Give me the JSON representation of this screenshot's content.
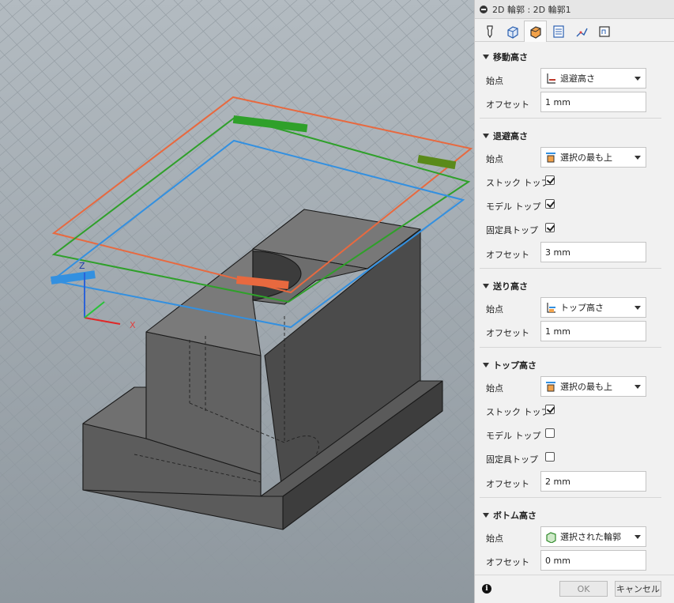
{
  "panel": {
    "title": "2D 輪郭 : 2D 輪郭1",
    "tabs": [
      {
        "icon": "tool-icon"
      },
      {
        "icon": "geometry-icon"
      },
      {
        "icon": "heights-icon"
      },
      {
        "icon": "passes-icon"
      },
      {
        "icon": "linking-icon"
      },
      {
        "icon": "shape-icon"
      }
    ]
  },
  "sections": {
    "clearance": {
      "title": "移動高さ",
      "start_label": "始点",
      "start_value": "退避高さ",
      "offset_label": "オフセット",
      "offset_value": "1 mm"
    },
    "retract": {
      "title": "退避高さ",
      "start_label": "始点",
      "start_value": "選択の最も上",
      "stock_top_label": "ストック トップ",
      "stock_top_checked": true,
      "model_top_label": "モデル トップ",
      "model_top_checked": true,
      "fixture_top_label": "固定具トップ",
      "fixture_top_checked": true,
      "offset_label": "オフセット",
      "offset_value": "3 mm"
    },
    "feed": {
      "title": "送り高さ",
      "start_label": "始点",
      "start_value": "トップ高さ",
      "offset_label": "オフセット",
      "offset_value": "1 mm"
    },
    "top": {
      "title": "トップ高さ",
      "start_label": "始点",
      "start_value": "選択の最も上",
      "stock_top_label": "ストック トップ",
      "stock_top_checked": true,
      "model_top_label": "モデル トップ",
      "model_top_checked": false,
      "fixture_top_label": "固定具トップ",
      "fixture_top_checked": false,
      "offset_label": "オフセット",
      "offset_value": "2 mm"
    },
    "bottom": {
      "title": "ボトム高さ",
      "start_label": "始点",
      "start_value": "選択された輪郭",
      "offset_label": "オフセット",
      "offset_value": "0 mm"
    }
  },
  "footer": {
    "info_icon": "i",
    "ok_label": "OK",
    "cancel_label": "キャンセル"
  },
  "viewport": {
    "axis_z": "Z",
    "axis_x": "X",
    "plane_colors": {
      "clearance": "#e8693f",
      "retract": "#2fa02a",
      "feed": "#3390e0"
    }
  }
}
